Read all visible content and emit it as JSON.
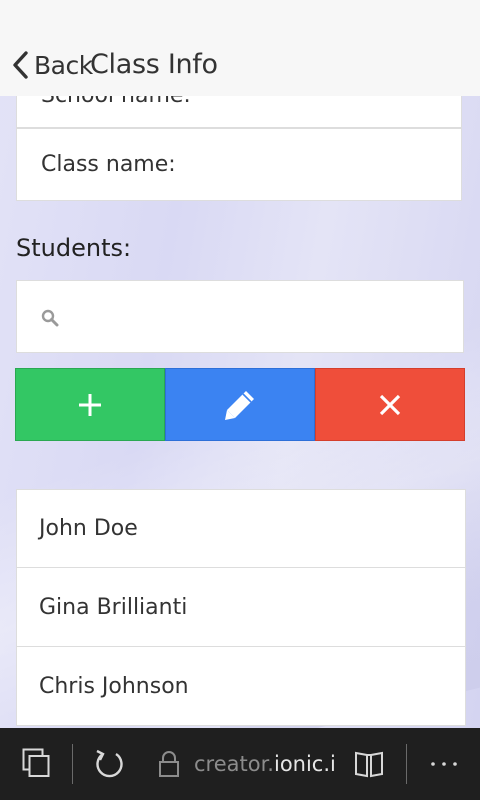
{
  "header": {
    "back_label": "Back",
    "title": "Class Info"
  },
  "form": {
    "school_label": "School name:",
    "class_label": "Class name:"
  },
  "students": {
    "label": "Students:",
    "search_placeholder": "",
    "actions": {
      "add_icon": "plus-icon",
      "edit_icon": "pencil-icon",
      "delete_icon": "close-icon"
    },
    "items": [
      {
        "name": "John Doe"
      },
      {
        "name": "Gina Brillianti"
      },
      {
        "name": "Chris Johnson"
      }
    ]
  },
  "colors": {
    "add": "#33c764",
    "edit": "#3b83f2",
    "delete": "#ef4e3a"
  },
  "browser": {
    "url_prefix": "creator.",
    "url_domain": "ionic.io"
  }
}
